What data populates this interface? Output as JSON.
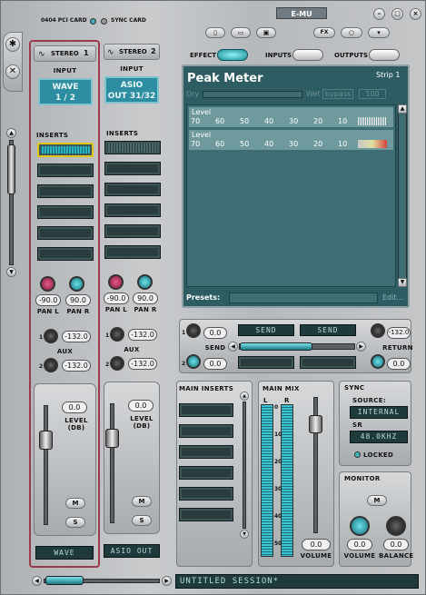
{
  "header": {
    "card_label": "0404 PCI CARD",
    "sync_label": "SYNC CARD",
    "brand": "E-MU"
  },
  "toolbar": {
    "fx": "FX",
    "new_icon": "new-doc-icon",
    "open_icon": "open-folder-icon",
    "save_icon": "save-icon"
  },
  "strips": [
    {
      "name": "STEREO",
      "number": "1",
      "input_label": "INPUT",
      "input_line1": "WAVE",
      "input_line2": "1 / 2",
      "inserts_label": "INSERTS",
      "pan_l": "-90.0",
      "pan_r": "90.0",
      "pan_l_label": "PAN L",
      "pan_r_label": "PAN R",
      "aux_label": "AUX",
      "aux1": "-132.0",
      "aux2": "-132.0",
      "level": "0.0",
      "level_label": "LEVEL (DB)",
      "mute": "M",
      "solo": "S",
      "bottom_name": "WAVE"
    },
    {
      "name": "STEREO",
      "number": "2",
      "input_label": "INPUT",
      "input_line1": "ASIO",
      "input_line2": "OUT 31/32",
      "inserts_label": "INSERTS",
      "pan_l": "-90.0",
      "pan_r": "90.0",
      "pan_l_label": "PAN L",
      "pan_r_label": "PAN R",
      "aux_label": "AUX",
      "aux1": "-132.0",
      "aux2": "-132.0",
      "level": "0.0",
      "level_label": "LEVEL (DB)",
      "mute": "M",
      "solo": "S",
      "bottom_name": "ASIO OUT"
    }
  ],
  "tabs": {
    "effect": "EFFECT",
    "inputs": "INPUTS",
    "outputs": "OUTPUTS"
  },
  "effect": {
    "title": "Peak Meter",
    "strip": "Strip 1",
    "dry": "Dry",
    "wet": "Wet",
    "bypass": "bypass",
    "value": "100",
    "level1": "Level",
    "level2": "Level",
    "scale": [
      "70",
      "60",
      "50",
      "40",
      "30",
      "20",
      "10"
    ],
    "presets": "Presets:",
    "edit": "Edit..."
  },
  "send": {
    "label": "SEND",
    "label_a": "SEND",
    "label_b": "SEND",
    "return_label": "RETURN",
    "s1": "0.0",
    "s2": "0.0",
    "r1": "-132.0",
    "r2": "0.0"
  },
  "main_inserts": {
    "label": "MAIN INSERTS"
  },
  "main_mix": {
    "label": "MAIN MIX",
    "l": "L",
    "r": "R",
    "scale": [
      "0",
      "10",
      "20",
      "30",
      "40",
      "50"
    ],
    "volume": "0.0",
    "volume_label": "VOLUME"
  },
  "sync": {
    "label": "SYNC",
    "source_label": "SOURCE:",
    "source": "INTERNAL",
    "sr_label": "SR",
    "sr": "48.0KHZ",
    "locked": "LOCKED"
  },
  "monitor": {
    "label": "MONITOR",
    "mute": "M",
    "volume": "0.0",
    "balance": "0.0",
    "volume_label": "VOLUME",
    "balance_label": "BALANCE"
  },
  "session": {
    "name": "UNTITLED SESSION*"
  }
}
